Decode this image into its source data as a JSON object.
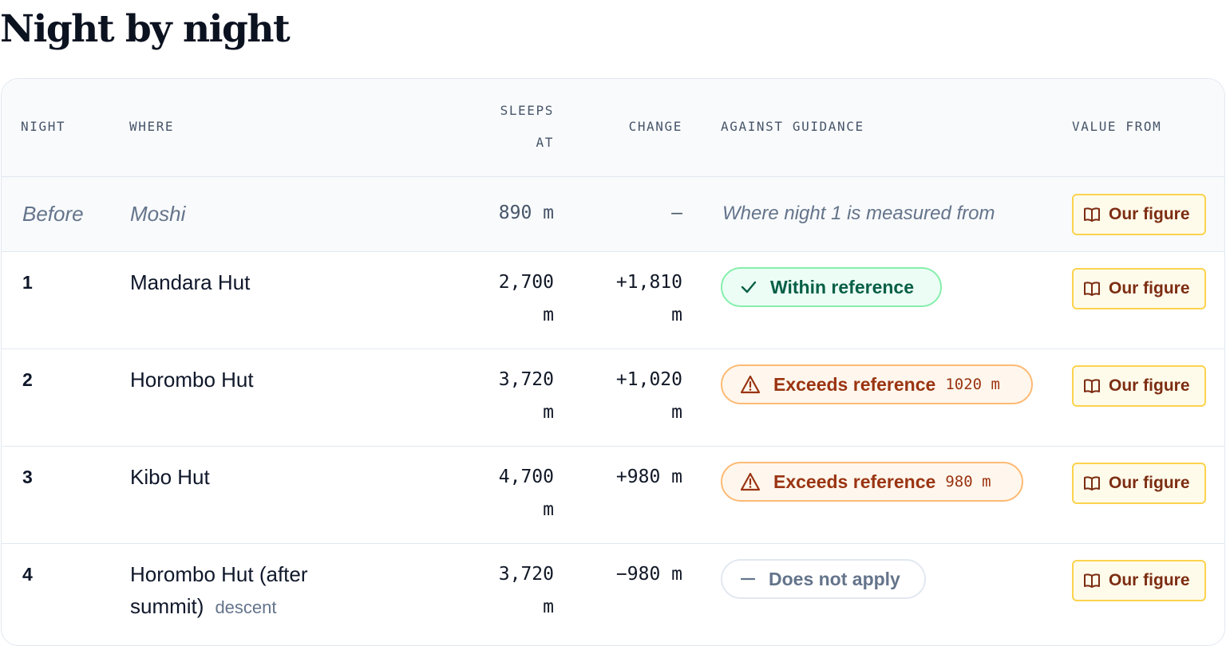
{
  "title": "Night by night",
  "columns": {
    "night": "NIGHT",
    "where": "WHERE",
    "sleeps_line1": "SLEEPS",
    "sleeps_line2": "AT",
    "change": "CHANGE",
    "guidance": "AGAINST GUIDANCE",
    "source": "VALUE FROM"
  },
  "rows": [
    {
      "night": "Before",
      "where": "Moshi",
      "sleeps": "890 m",
      "change": "—",
      "guidance_note": "Where night 1 is measured from",
      "source": "Our figure"
    },
    {
      "night": "1",
      "where": "Mandara Hut",
      "sleeps_a": "2,700",
      "sleeps_b": "m",
      "change_a": "+1,810",
      "change_b": "m",
      "guidance": "Within reference",
      "status": "within",
      "source": "Our figure"
    },
    {
      "night": "2",
      "where": "Horombo Hut",
      "sleeps_a": "3,720",
      "sleeps_b": "m",
      "change_a": "+1,020",
      "change_b": "m",
      "guidance": "Exceeds reference",
      "amount": "1020 m",
      "status": "exceeds",
      "source": "Our figure"
    },
    {
      "night": "3",
      "where": "Kibo Hut",
      "sleeps_a": "4,700",
      "sleeps_b": "m",
      "change": "+980 m",
      "guidance": "Exceeds reference",
      "amount": "980 m",
      "status": "exceeds",
      "source": "Our figure"
    },
    {
      "night": "4",
      "where_a": "Horombo Hut (after",
      "where_b": "summit)",
      "tag": "descent",
      "sleeps_a": "3,720",
      "sleeps_b": "m",
      "change": "−980 m",
      "guidance": "Does not apply",
      "status": "na",
      "source": "Our figure"
    }
  ],
  "colors": {
    "within": "#065f46",
    "exceeds": "#9a3412",
    "na": "#64748b",
    "source_border": "#fcd34d"
  },
  "icons": {
    "within": "check-icon",
    "exceeds": "warning-triangle-icon",
    "na": "dash-icon",
    "source": "book-icon"
  }
}
